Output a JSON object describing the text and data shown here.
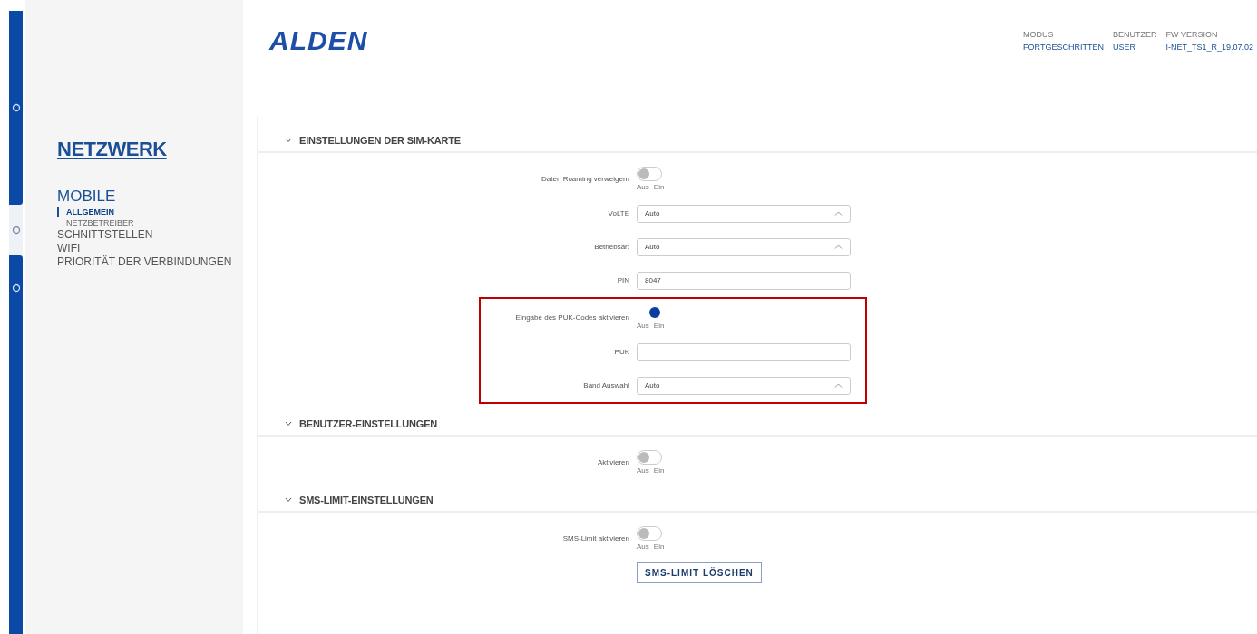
{
  "nav_rail": [
    {
      "selected": true
    },
    {
      "selected": false
    },
    {
      "selected": true
    }
  ],
  "sidebar": {
    "title": "NETZWERK",
    "items": [
      {
        "label": "MOBILE",
        "selected": false,
        "children": [
          {
            "label": "ALLGEMEIN",
            "selected": true
          },
          {
            "label": "NETZBETREIBER",
            "selected": false
          }
        ]
      },
      {
        "label": "SCHNITTSTELLEN",
        "selected": false
      },
      {
        "label": "WIFI",
        "selected": false
      },
      {
        "label": "PRIORITÄT DER VERBINDUNGEN",
        "selected": false
      }
    ]
  },
  "header": {
    "logo": "ALDEN",
    "info": [
      {
        "label": "MODUS",
        "value": "FORTGESCHRITTEN"
      },
      {
        "label": "BENUTZER",
        "value": "USER"
      },
      {
        "label": "FW VERSION",
        "value": "I-NET_TS1_R_19.07.02"
      }
    ]
  },
  "sections": [
    {
      "title": "EINSTELLUNGEN DER SIM-KARTE",
      "expanded": true,
      "groups": [
        {
          "highlighted": false,
          "rows": [
            {
              "kind": "toggle",
              "label": "Daten Roaming verweigern",
              "on": false,
              "off_label": "Aus",
              "on_label": "Ein"
            },
            {
              "kind": "select",
              "label": "VoLTE",
              "value": "Auto"
            },
            {
              "kind": "select",
              "label": "Betriebsart",
              "value": "Auto"
            },
            {
              "kind": "input",
              "label": "PIN",
              "value": "8047"
            }
          ]
        },
        {
          "highlighted": true,
          "rows": [
            {
              "kind": "toggle",
              "label": "Eingabe des PUK-Codes aktivieren",
              "on": true,
              "off_label": "Aus",
              "on_label": "Ein"
            },
            {
              "kind": "input",
              "label": "PUK",
              "value": ""
            },
            {
              "kind": "select",
              "label": "Band Auswahl",
              "value": "Auto"
            }
          ]
        }
      ]
    },
    {
      "title": "BENUTZER-EINSTELLUNGEN",
      "expanded": true,
      "groups": [
        {
          "highlighted": false,
          "rows": [
            {
              "kind": "toggle",
              "label": "Aktivieren",
              "on": false,
              "off_label": "Aus",
              "on_label": "Ein"
            }
          ]
        }
      ]
    },
    {
      "title": "SMS-LIMIT-EINSTELLUNGEN",
      "expanded": true,
      "groups": [
        {
          "highlighted": false,
          "rows": [
            {
              "kind": "toggle",
              "label": "SMS-Limit aktivieren",
              "on": false,
              "off_label": "Aus",
              "on_label": "Ein"
            },
            {
              "kind": "button",
              "label": "SMS-LIMIT LÖSCHEN"
            }
          ]
        }
      ]
    }
  ]
}
